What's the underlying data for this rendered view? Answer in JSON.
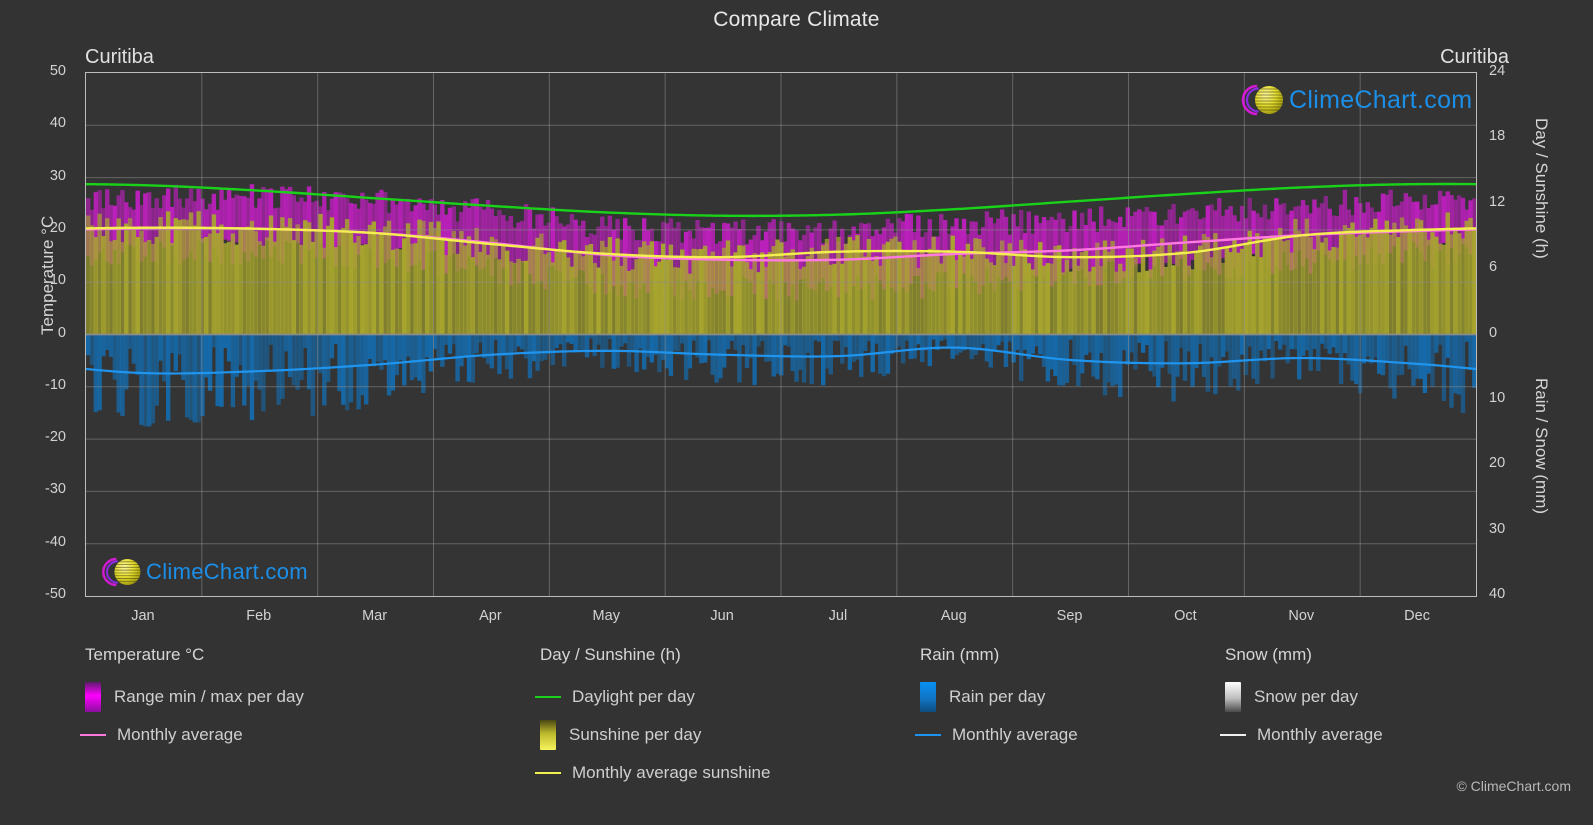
{
  "header": {
    "title": "Compare Climate",
    "location_left": "Curitiba",
    "location_right": "Curitiba"
  },
  "axes": {
    "left_title": "Temperature °C",
    "right_title_top": "Day / Sunshine (h)",
    "right_title_bottom": "Rain / Snow (mm)",
    "left_ticks": [
      "50",
      "40",
      "30",
      "20",
      "10",
      "0",
      "-10",
      "-20",
      "-30",
      "-40",
      "-50"
    ],
    "right_ticks_top": [
      "24",
      "18",
      "12",
      "6",
      "0"
    ],
    "right_ticks_bottom": [
      "10",
      "20",
      "30",
      "40"
    ],
    "x_ticks": [
      "Jan",
      "Feb",
      "Mar",
      "Apr",
      "May",
      "Jun",
      "Jul",
      "Aug",
      "Sep",
      "Oct",
      "Nov",
      "Dec"
    ]
  },
  "watermark": {
    "text": "ClimeChart.com"
  },
  "legend": {
    "columns": [
      {
        "heading": "Temperature °C",
        "entries": [
          {
            "label": "Range min / max per day",
            "marker": "swatch",
            "color": "#ff00ff"
          },
          {
            "label": "Monthly average",
            "marker": "line",
            "color": "#ff7ae0"
          }
        ]
      },
      {
        "heading": "Day / Sunshine (h)",
        "entries": [
          {
            "label": "Daylight per day",
            "marker": "line",
            "color": "#19d219"
          },
          {
            "label": "Sunshine per day",
            "marker": "swatch",
            "color": "#f2ef4e"
          },
          {
            "label": "Monthly average sunshine",
            "marker": "line",
            "color": "#f2ef4e"
          }
        ]
      },
      {
        "heading": "Rain (mm)",
        "entries": [
          {
            "label": "Rain per day",
            "marker": "swatch",
            "color": "#0a85e8"
          },
          {
            "label": "Monthly average",
            "marker": "line",
            "color": "#1f95ef"
          }
        ]
      },
      {
        "heading": "Snow (mm)",
        "entries": [
          {
            "label": "Snow per day",
            "marker": "swatch",
            "color": "#ffffff"
          },
          {
            "label": "Monthly average",
            "marker": "line",
            "color": "#f0f0f0"
          }
        ]
      }
    ],
    "copyright": "© ClimeChart.com"
  },
  "colors": {
    "background": "#333333",
    "plot_background": "#343434",
    "grid": "#8d8d8d",
    "temp_range": "#c01fc0",
    "temp_avg": "#ff7ae0",
    "daylight": "#19d219",
    "sunshine_fill": "#a8a62e",
    "sunshine_avg": "#f2ef4e",
    "rain_fill": "#1669a8",
    "rain_avg": "#1f95ef",
    "axis": "#bdbdbd",
    "text": "#d4d4d4"
  },
  "chart_data": {
    "type": "area",
    "title": "Compare Climate",
    "subtitle": "Curitiba",
    "xlabel": "",
    "ylabel": "Temperature °C",
    "ylim": [
      -50,
      50
    ],
    "grid": true,
    "legend_position": "bottom",
    "categories": [
      "Jan",
      "Feb",
      "Mar",
      "Apr",
      "May",
      "Jun",
      "Jul",
      "Aug",
      "Sep",
      "Oct",
      "Nov",
      "Dec"
    ],
    "axis_right_top": {
      "label": "Day / Sunshine (h)",
      "range": [
        0,
        24
      ]
    },
    "axis_right_bottom": {
      "label": "Rain / Snow (mm)",
      "range": [
        0,
        40
      ]
    },
    "series": [
      {
        "name": "Daylight per day",
        "unit": "h",
        "color": "#19d219",
        "values": [
          13.7,
          13.2,
          12.5,
          11.8,
          11.2,
          10.9,
          11.0,
          11.5,
          12.2,
          12.9,
          13.5,
          13.8
        ]
      },
      {
        "name": "Monthly average sunshine",
        "unit": "h",
        "color": "#f2ef4e",
        "values": [
          9.8,
          9.7,
          9.3,
          8.3,
          7.4,
          7.1,
          7.6,
          7.6,
          7.1,
          7.5,
          9.1,
          9.6
        ]
      },
      {
        "name": "Temperature monthly average",
        "unit": "°C",
        "color": "#ff7ae0",
        "values": [
          20.3,
          20.2,
          19.4,
          17.5,
          15.2,
          14.3,
          14.3,
          15.4,
          16.1,
          17.6,
          19.0,
          19.8
        ]
      },
      {
        "name": "Temperature range max per day",
        "unit": "°C",
        "color": "#c01fc0",
        "values": [
          26.0,
          26.0,
          25.0,
          23.0,
          20.5,
          19.5,
          19.5,
          21.0,
          21.5,
          23.0,
          24.5,
          25.5
        ]
      },
      {
        "name": "Temperature range min per day",
        "unit": "°C",
        "color": "#c01fc0",
        "values": [
          16.0,
          16.0,
          15.0,
          12.5,
          10.0,
          9.0,
          9.0,
          10.0,
          11.5,
          13.0,
          14.0,
          15.5
        ]
      },
      {
        "name": "Rain monthly average",
        "unit": "mm",
        "color": "#1f95ef",
        "values": [
          5.9,
          5.6,
          4.6,
          3.1,
          2.5,
          3.1,
          3.3,
          2.0,
          3.9,
          4.4,
          3.6,
          4.5
        ]
      },
      {
        "name": "Snow monthly average",
        "unit": "mm",
        "color": "#f0f0f0",
        "values": [
          0,
          0,
          0,
          0,
          0,
          0,
          0,
          0,
          0,
          0,
          0,
          0
        ]
      }
    ]
  }
}
